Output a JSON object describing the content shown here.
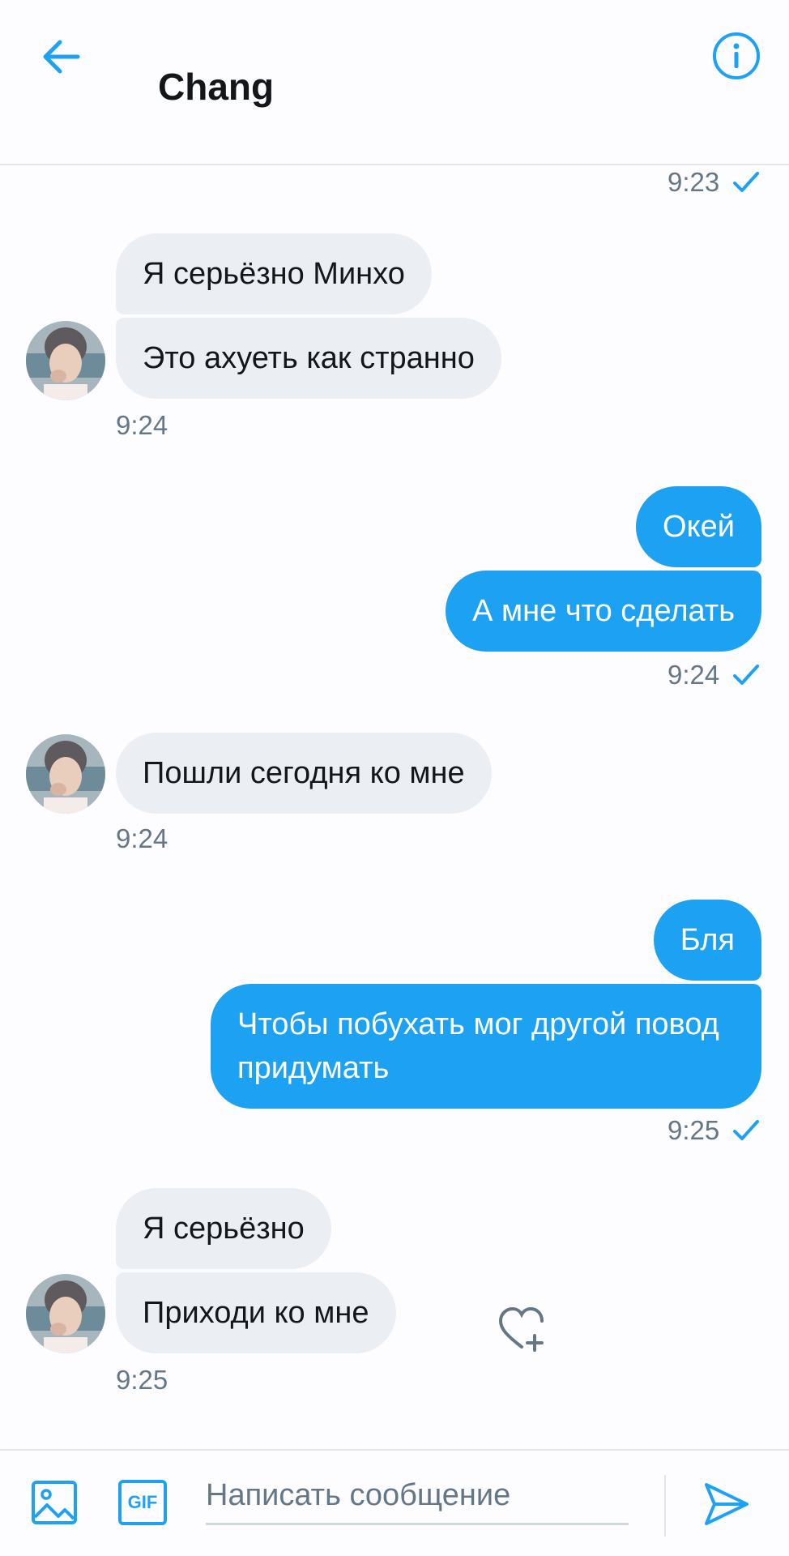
{
  "header": {
    "title": "Chang",
    "back_icon": "arrow-left-icon",
    "info_icon": "info-icon"
  },
  "colors": {
    "accent": "#1da1f2",
    "incoming_bubble": "#ebeef3",
    "timestamp": "#657786"
  },
  "messages": {
    "top_timestamp": "9:23",
    "group1": {
      "bubbles": [
        "Я серьёзно Минхо",
        "Это ахуеть как странно"
      ],
      "time": "9:24"
    },
    "group2": {
      "bubbles": [
        "Окей",
        "А мне что сделать"
      ],
      "time": "9:24"
    },
    "group3": {
      "bubbles": [
        "Пошли сегодня ко мне"
      ],
      "time": "9:24"
    },
    "group4": {
      "bubbles": [
        "Бля",
        "Чтобы побухать мог другой повод придумать"
      ],
      "time": "9:25"
    },
    "group5": {
      "bubbles": [
        "Я серьёзно",
        "Приходи ко мне"
      ],
      "time": "9:25"
    }
  },
  "composer": {
    "placeholder": "Написать сообщение",
    "gif_label": "GIF",
    "image_icon": "image-icon",
    "send_icon": "send-icon"
  }
}
